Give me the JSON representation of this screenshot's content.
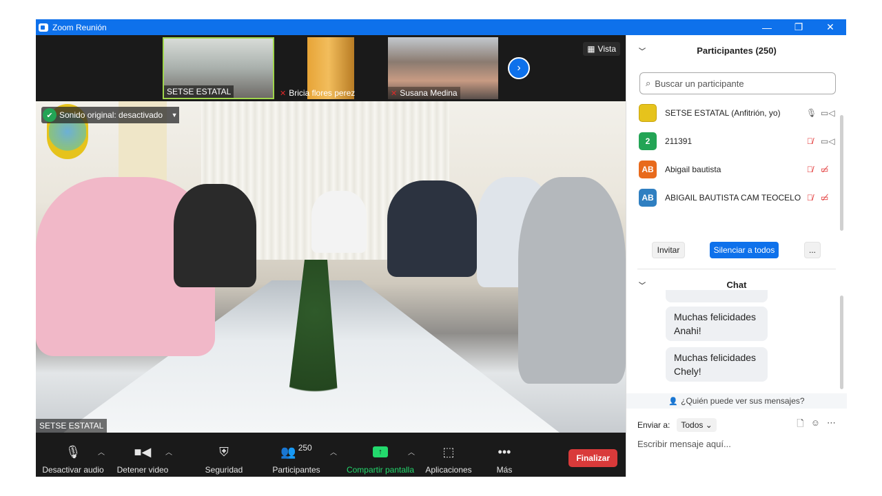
{
  "window": {
    "title": "Zoom Reunión",
    "minimize": "—",
    "restore": "❐",
    "close": "✕"
  },
  "strip": {
    "thumbs": [
      {
        "name": "SETSE ESTATAL"
      },
      {
        "name": "Bricia flores perez"
      },
      {
        "name": "Susana Medina"
      }
    ],
    "next": "›",
    "view_label": "Vista"
  },
  "main": {
    "original_sound": "Sonido original: desactivado",
    "speaker_name": "SETSE ESTATAL"
  },
  "toolbar": {
    "mute_label": "Desactivar audio",
    "video_label": "Detener video",
    "security_label": "Seguridad",
    "participants_label": "Participantes",
    "participants_count": "250",
    "share_label": "Compartir pantalla",
    "apps_label": "Aplicaciones",
    "more_label": "Más",
    "end_label": "Finalizar"
  },
  "panel": {
    "participants_title": "Participantes (250)",
    "search_placeholder": "Buscar un participante",
    "participants": [
      {
        "avatar": "",
        "name": "SETSE ESTATAL (Anfitrión, yo)",
        "color": "#e6c31c"
      },
      {
        "avatar": "2",
        "name": "211391",
        "color": "#23a455"
      },
      {
        "avatar": "AB",
        "name": "Abigail bautista",
        "color": "#e86a1c"
      },
      {
        "avatar": "AB",
        "name": "ABIGAIL BAUTISTA CAM TEOCELO",
        "color": "#2f7fc1"
      }
    ],
    "invite_label": "Invitar",
    "mute_all_label": "Silenciar a todos",
    "more_label": "...",
    "chat_title": "Chat",
    "messages": [
      {
        "text": "Muchas felicidades Anahi!"
      },
      {
        "text": "Muchas felicidades Chely!"
      }
    ],
    "who_can_see": "¿Quién puede ver sus mensajes?",
    "send_to_label": "Enviar a:",
    "send_to_value": "Todos",
    "message_placeholder": "Escribir mensaje aquí..."
  },
  "colors": {
    "accent": "#0e71eb",
    "end": "#d93a3a",
    "share": "#23d96d"
  }
}
